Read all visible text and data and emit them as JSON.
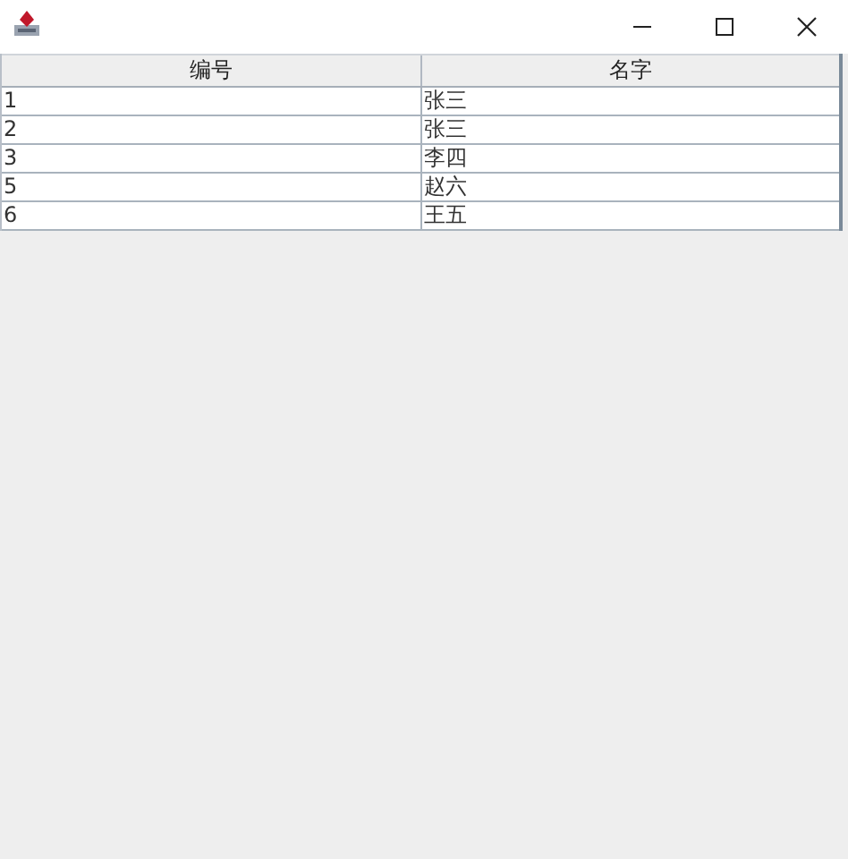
{
  "table": {
    "columns": [
      "编号",
      "名字"
    ],
    "rows": [
      [
        "1",
        "张三"
      ],
      [
        "2",
        "张三"
      ],
      [
        "3",
        "李四"
      ],
      [
        "5",
        "赵六"
      ],
      [
        "6",
        "王五"
      ]
    ]
  }
}
